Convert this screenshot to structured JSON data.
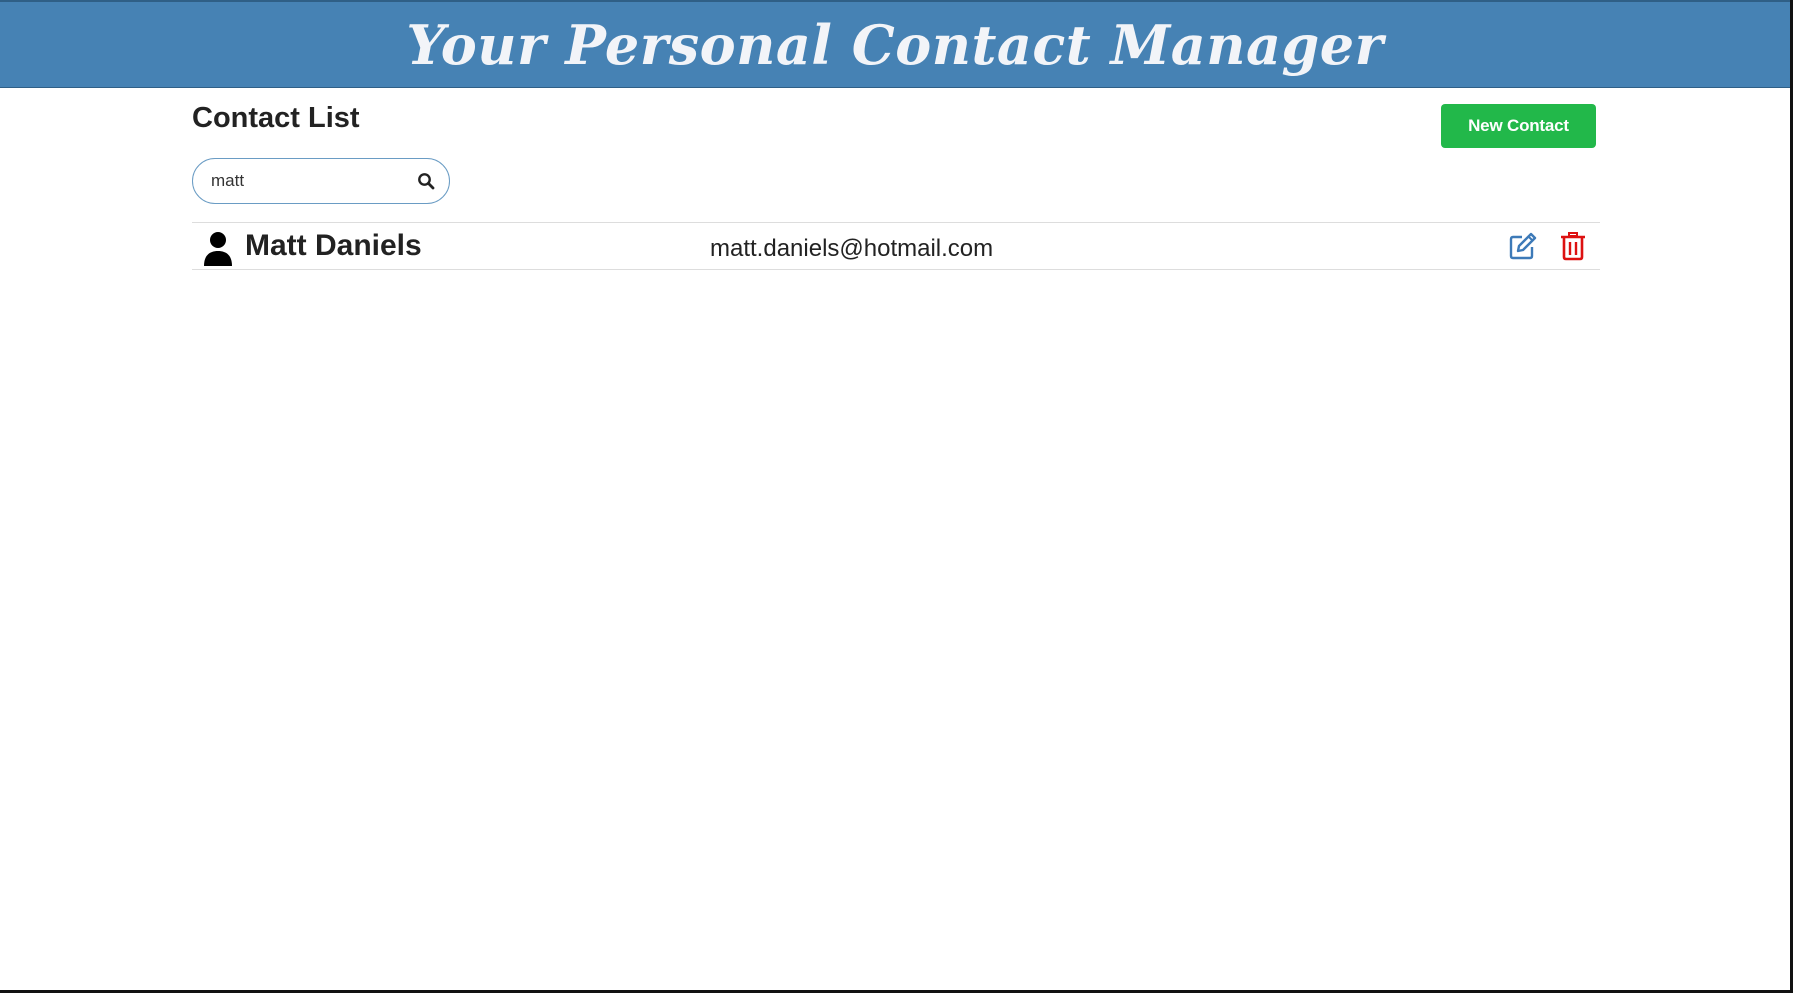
{
  "header": {
    "title": "Your Personal Contact Manager"
  },
  "main": {
    "page_title": "Contact List",
    "new_contact_label": "New Contact",
    "search": {
      "value": "matt",
      "icon": "search-icon"
    },
    "contacts": [
      {
        "name": "Matt Daniels",
        "email": "matt.daniels@hotmail.com",
        "avatar_icon": "user-icon",
        "edit_icon": "edit-icon",
        "delete_icon": "trash-icon"
      }
    ]
  },
  "colors": {
    "header_bg": "#4682b4",
    "header_text": "#f2f4f8",
    "new_contact_bg": "#22b84a",
    "edit_icon": "#3d7ab8",
    "delete_icon": "#dd1111",
    "search_border": "#6a9cc4"
  }
}
